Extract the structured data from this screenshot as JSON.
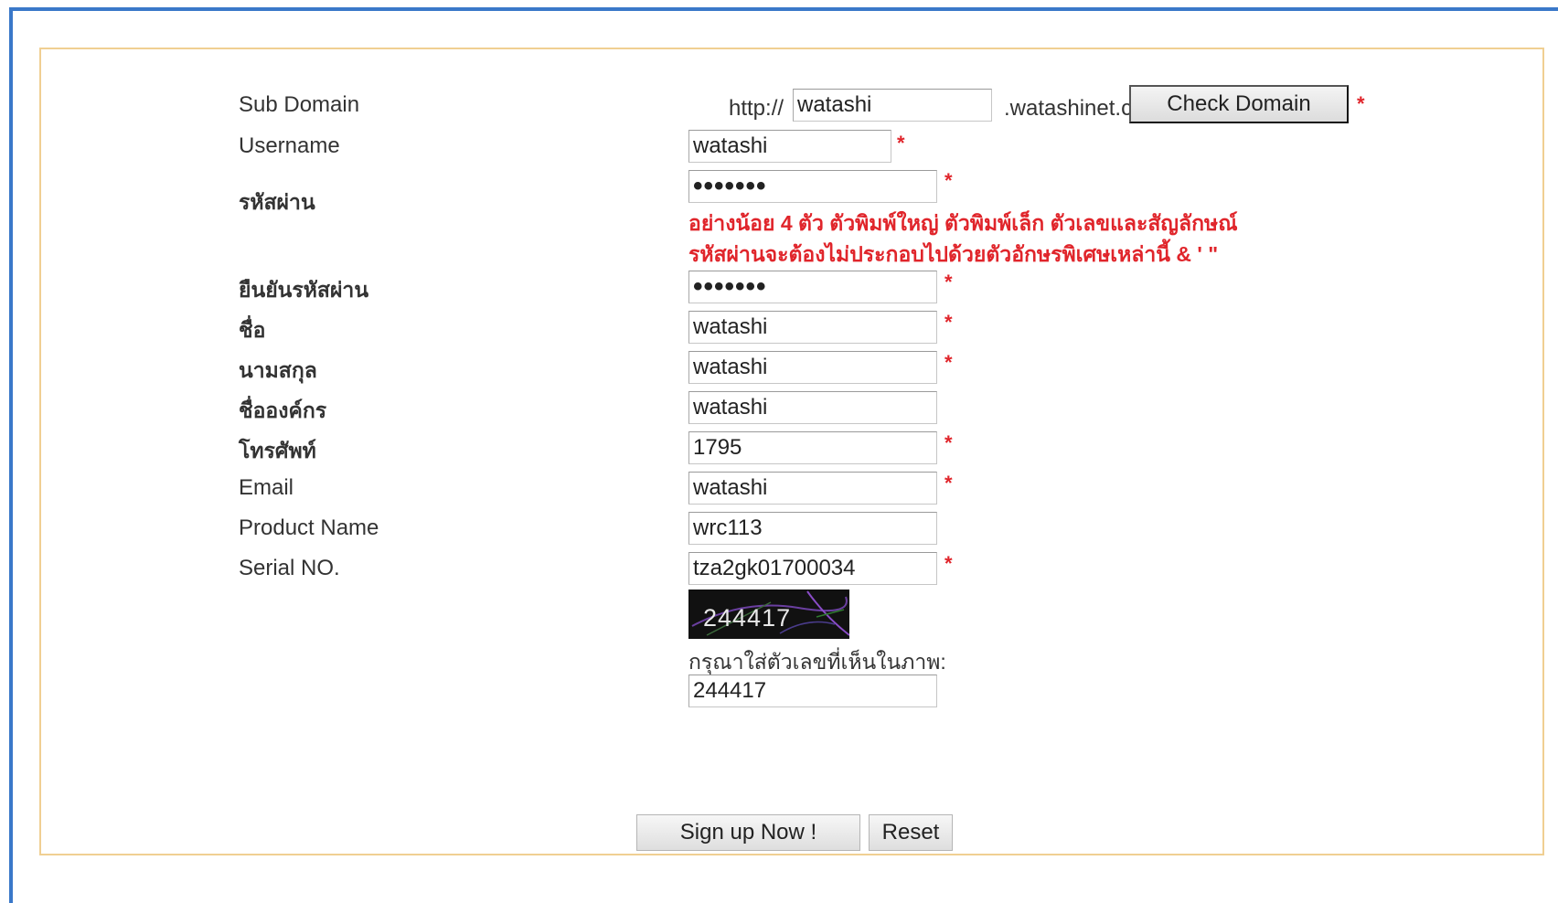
{
  "form": {
    "subdomain": {
      "label": "Sub Domain",
      "prefix": "http://",
      "value": "watashi",
      "suffix": ".watashinet.com",
      "check_button": "Check Domain"
    },
    "username": {
      "label": "Username",
      "value": "watashi"
    },
    "password": {
      "label": "รหัสผ่าน",
      "value": "watashi",
      "hint_line1": "อย่างน้อย 4 ตัว ตัวพิมพ์ใหญ่ ตัวพิมพ์เล็ก ตัวเลขและสัญลักษณ์",
      "hint_line2": "รหัสผ่านจะต้องไม่ประกอบไปด้วยตัวอักษรพิเศษเหล่านี้ & ' \""
    },
    "confirm_password": {
      "label": "ยืนยันรหัสผ่าน",
      "value": "watashi"
    },
    "first_name": {
      "label": "ชื่อ",
      "value": "watashi"
    },
    "last_name": {
      "label": "นามสกุล",
      "value": "watashi"
    },
    "organization": {
      "label": "ชื่อองค์กร",
      "value": "watashi"
    },
    "phone": {
      "label": "โทรศัพท์",
      "value": "1795"
    },
    "email": {
      "label": "Email",
      "value": "watashi"
    },
    "product_name": {
      "label": "Product Name",
      "value": "wrc113"
    },
    "serial_no": {
      "label": "Serial NO.",
      "value": "tza2gk01700034"
    },
    "captcha": {
      "image_text": "244417",
      "prompt": "กรุณาใส่ตัวเลขที่เห็นในภาพ:",
      "value": "244417"
    },
    "required_mark": "*",
    "signup_button": "Sign up Now !",
    "reset_button": "Reset"
  },
  "colors": {
    "required": "#e0252b",
    "frame": "#3a78c9",
    "panel_border": "#f0cf92"
  }
}
